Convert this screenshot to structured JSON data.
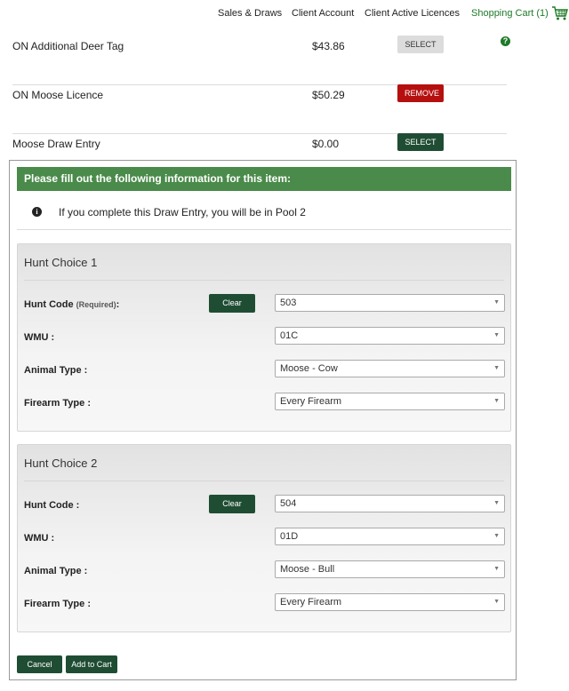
{
  "nav": {
    "sales_draws": "Sales & Draws",
    "client_account": "Client Account",
    "client_active_licences": "Client Active Licences",
    "shopping_cart": "Shopping Cart  (1)"
  },
  "items": [
    {
      "name": "ON Additional Deer Tag",
      "price": "$43.86",
      "button": "SELECT"
    },
    {
      "name": "ON Moose Licence",
      "price": "$50.29",
      "button": "REMOVE"
    },
    {
      "name": "Moose Draw Entry",
      "price": "$0.00",
      "button": "SELECT"
    }
  ],
  "panel": {
    "header": "Please fill out the following information for this item:",
    "info_text": "If you complete this Draw Entry, you will be in Pool 2"
  },
  "hunt_choices": [
    {
      "title": "Hunt Choice 1",
      "hunt_code_label": "Hunt Code",
      "hunt_code_required": "(Required)",
      "hunt_code_suffix": ":",
      "clear_label": "Clear",
      "hunt_code_value": "503",
      "wmu_label": "WMU :",
      "wmu_value": "01C",
      "animal_type_label": "Animal Type :",
      "animal_type_value": "Moose - Cow",
      "firearm_type_label": "Firearm Type :",
      "firearm_type_value": "Every Firearm"
    },
    {
      "title": "Hunt Choice 2",
      "hunt_code_label": "Hunt Code :",
      "clear_label": "Clear",
      "hunt_code_value": "504",
      "wmu_label": "WMU :",
      "wmu_value": "01D",
      "animal_type_label": "Animal Type :",
      "animal_type_value": "Moose - Bull",
      "firearm_type_label": "Firearm Type :",
      "firearm_type_value": "Every Firearm"
    }
  ],
  "actions": {
    "cancel": "Cancel",
    "add_to_cart": "Add to Cart"
  },
  "icons": {
    "cart": "shopping-cart-icon",
    "help": "question-circle-icon",
    "info": "info-circle-icon",
    "dropdown": "chevron-down-icon"
  },
  "colors": {
    "accent_green": "#1e7a28",
    "dark_green": "#1f4d33",
    "header_green": "#4a8a4a",
    "remove_red": "#b50f0f"
  }
}
